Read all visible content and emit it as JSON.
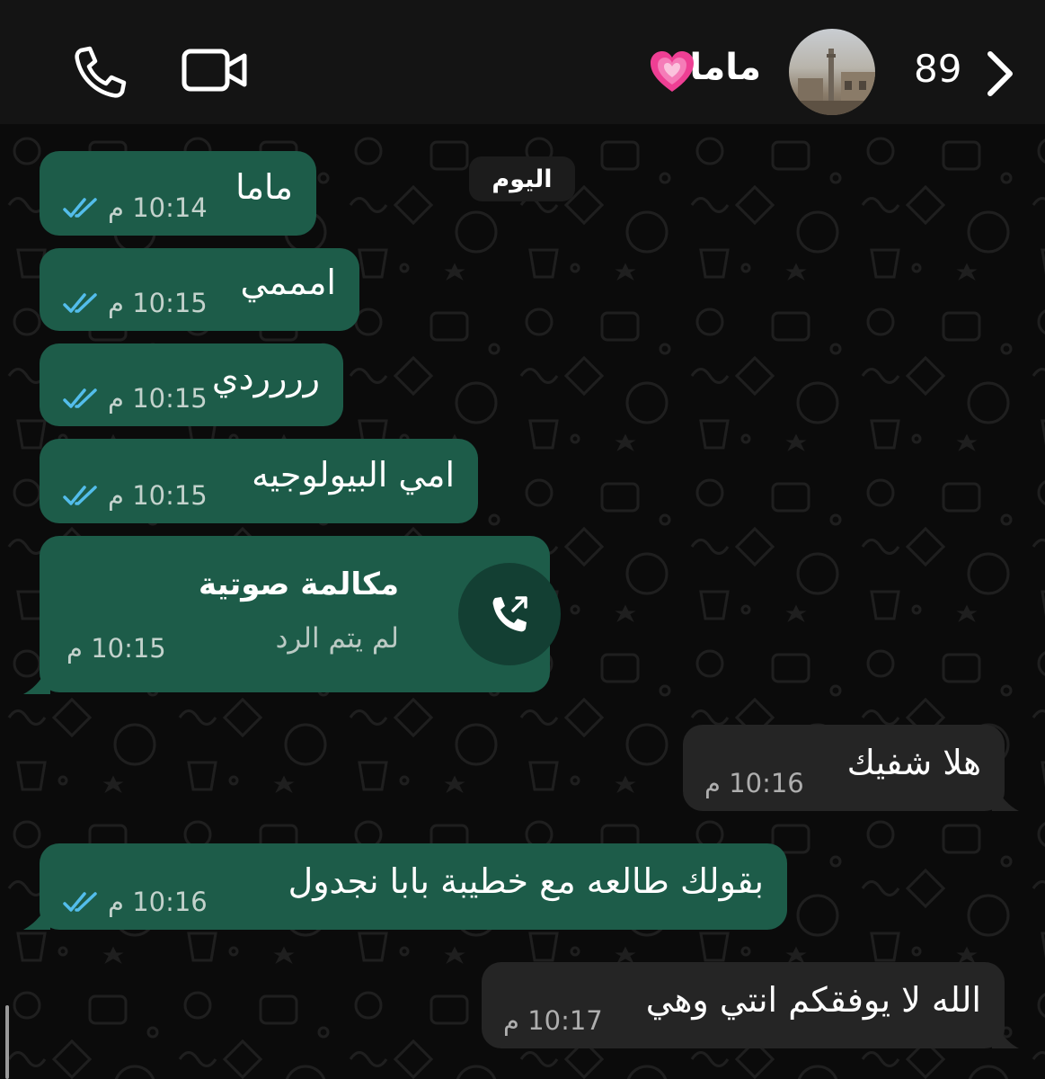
{
  "header": {
    "unread_count": "89",
    "contact_name": "ماما",
    "icons": [
      "chevron-right-icon",
      "heart-icon",
      "video-call-icon",
      "voice-call-icon"
    ]
  },
  "chat": {
    "date_label": "اليوم",
    "messages": [
      {
        "direction": "outgoing",
        "text": "ماما",
        "time": "10:14 م",
        "status": "read"
      },
      {
        "direction": "outgoing",
        "text": "امممي",
        "time": "10:15 م",
        "status": "read"
      },
      {
        "direction": "outgoing",
        "text": "رررردي",
        "time": "10:15 م",
        "status": "read"
      },
      {
        "direction": "outgoing",
        "text": "امي البيولوجيه",
        "time": "10:15 م",
        "status": "read"
      },
      {
        "direction": "outgoing",
        "type": "voice-call",
        "title": "مكالمة صوتية",
        "subtitle": "لم يتم الرد",
        "time": "10:15 م"
      },
      {
        "direction": "incoming",
        "text": "هلا شفيك",
        "time": "10:16 م"
      },
      {
        "direction": "outgoing",
        "text": "بقولك طالعه مع خطيبة بابا نجدول",
        "time": "10:16 م",
        "status": "read"
      },
      {
        "direction": "incoming",
        "text": "الله لا يوفقكم انتي وهي",
        "time": "10:17 م"
      }
    ]
  },
  "colors": {
    "header_bg": "#141414",
    "chat_bg": "#0b0b0b",
    "outgoing_bubble": "#1d5c49",
    "incoming_bubble": "#252525",
    "read_ticks": "#53bdeb"
  }
}
